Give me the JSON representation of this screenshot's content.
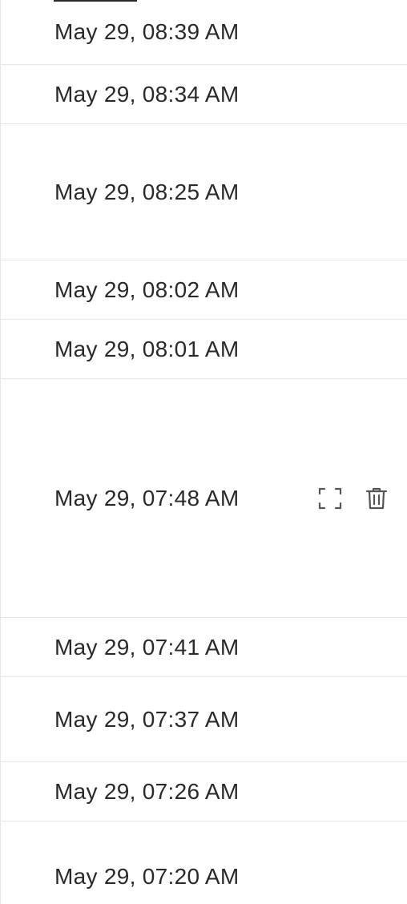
{
  "entries": [
    {
      "time": "May 29, 08:39 AM"
    },
    {
      "time": "May 29, 08:34 AM"
    },
    {
      "time": "May 29, 08:25 AM"
    },
    {
      "time": "May 29, 08:02 AM"
    },
    {
      "time": "May 29, 08:01 AM"
    },
    {
      "time": "May 29, 07:48 AM",
      "actions": [
        "expand-icon",
        "trash-icon"
      ]
    },
    {
      "time": "May 29, 07:41 AM"
    },
    {
      "time": "May 29, 07:37 AM"
    },
    {
      "time": "May 29, 07:26 AM"
    },
    {
      "time": "May 29, 07:20 AM"
    }
  ],
  "colors": {
    "text": "#2a2a2a",
    "divider": "#e6e6e6",
    "icon": "#555555"
  }
}
